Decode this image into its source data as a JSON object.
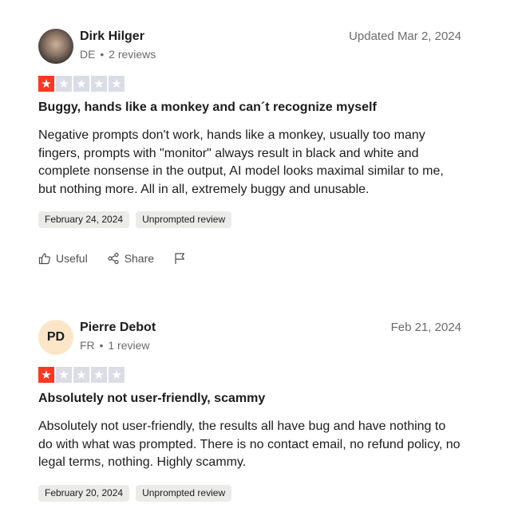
{
  "reviews": [
    {
      "name": "Dirk Hilger",
      "country": "DE",
      "review_count": "2 reviews",
      "date": "Updated Mar 2, 2024",
      "rating": 1,
      "title": "Buggy, hands like a monkey and can´t recognize myself",
      "body": "Negative prompts don't work, hands like a monkey, usually too many fingers, prompts with \"monitor\" always result in black and white and complete nonsense in the output, AI model looks maximal similar to me, but nothing more. All in all, extremely buggy and unusable.",
      "experience_date": "February 24, 2024",
      "tag": "Unprompted review",
      "useful_label": "Useful",
      "share_label": "Share"
    },
    {
      "name": "Pierre Debot",
      "initials": "PD",
      "country": "FR",
      "review_count": "1 review",
      "date": "Feb 21, 2024",
      "rating": 1,
      "title": "Absolutely not user-friendly, scammy",
      "body": "Absolutely not user-friendly, the results all have bug and have nothing to do with what was prompted. There is no contact email, no refund policy, no legal terms, nothing. Highly scammy.",
      "experience_date": "February 20, 2024",
      "tag": "Unprompted review"
    }
  ],
  "icons": {
    "star": "star-icon",
    "thumb": "thumbs-up-icon",
    "share": "share-icon",
    "flag": "flag-icon"
  },
  "colors": {
    "star_on": "#ff3722",
    "star_off": "#dcdce6",
    "tag_bg": "#ebebe9"
  }
}
